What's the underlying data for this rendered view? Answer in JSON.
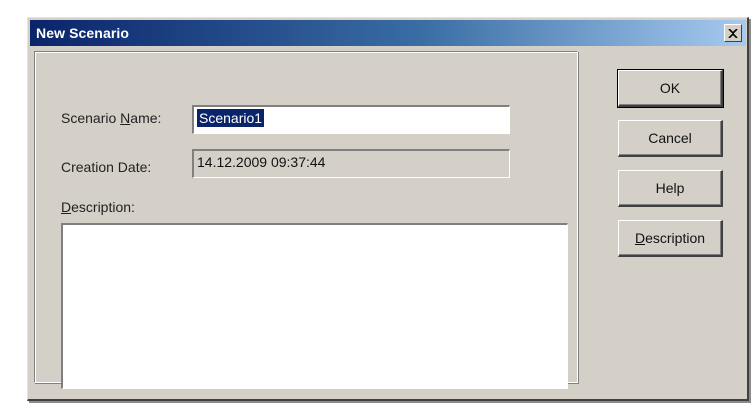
{
  "window": {
    "title": "New Scenario",
    "close_glyph": "×"
  },
  "form": {
    "scenario_name_label_pre": "Scenario ",
    "scenario_name_label_u": "N",
    "scenario_name_label_post": "ame:",
    "scenario_name_value": "Scenario1",
    "creation_date_label": "Creation Date:",
    "creation_date_value": "14.12.2009 09:37:44",
    "description_label_u": "D",
    "description_label_post": "escription:",
    "description_value": ""
  },
  "buttons": {
    "ok": "OK",
    "cancel": "Cancel",
    "help": "Help",
    "description_u": "D",
    "description_post": "escription"
  },
  "colors": {
    "title_gradient_start": "#0a246a",
    "title_gradient_end": "#a6caf0",
    "dialog_face": "#d4d0c8",
    "selection": "#0a246a"
  }
}
